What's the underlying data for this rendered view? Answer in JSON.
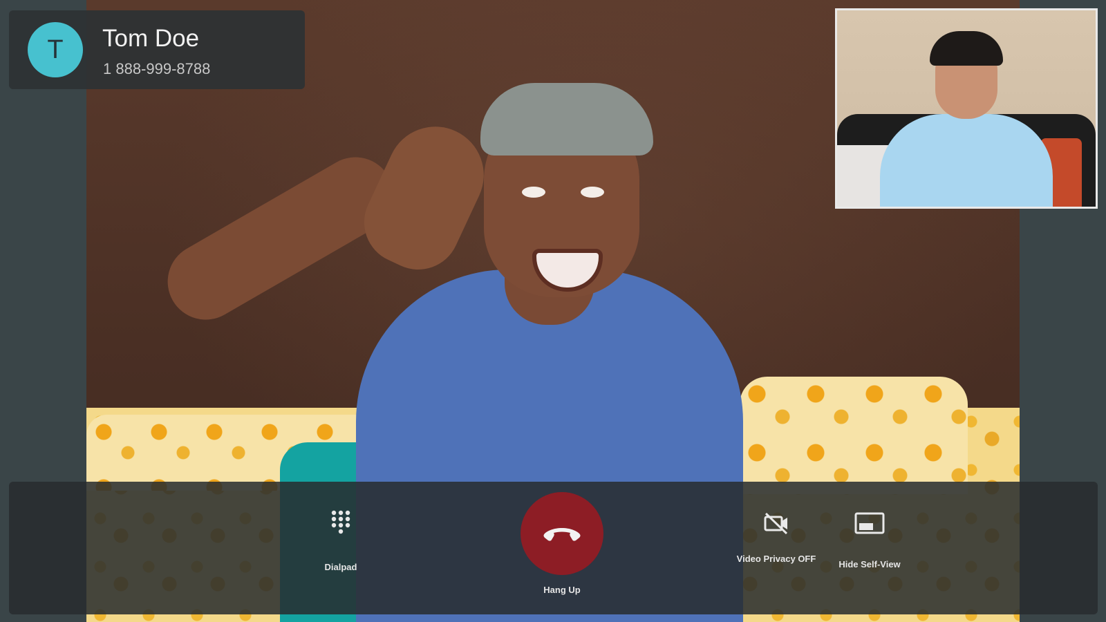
{
  "caller": {
    "initial": "T",
    "name": "Tom Doe",
    "number": "1 888-999-8788"
  },
  "controls": {
    "dialpad_label": "Dialpad",
    "hangup_label": "Hang Up",
    "video_privacy_label": "Video Privacy OFF",
    "hide_self_view_label": "Hide Self-View"
  },
  "icons": {
    "dialpad": "dialpad-icon",
    "hangup": "phone-hangup-icon",
    "video_privacy": "videocam-off-icon",
    "self_view": "picture-in-picture-icon"
  },
  "colors": {
    "avatar": "#47c1cf",
    "hangup": "#8d1d25",
    "panel": "#2e3234",
    "background": "#3a4548"
  }
}
